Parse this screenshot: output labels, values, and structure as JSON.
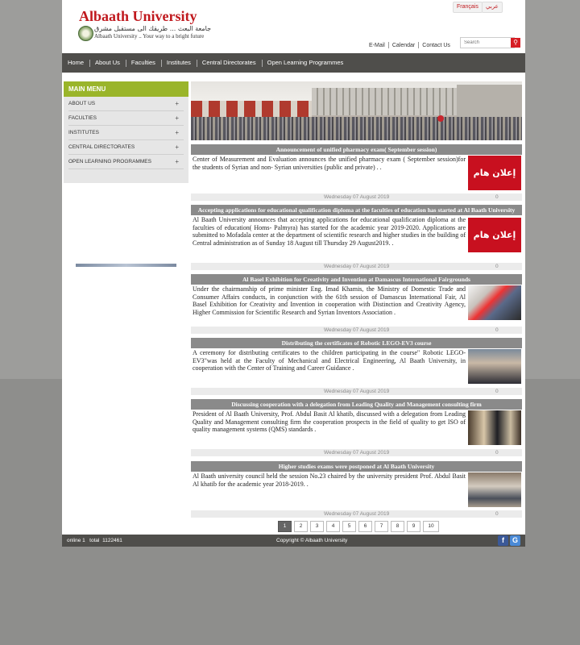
{
  "header": {
    "university_name": "Albaath University",
    "arabic_tagline": "جامعة البعث ... طريقك الى مستقبل مشرق",
    "slogan": "Albaath University .. Your way to a bright future",
    "languages": [
      "Français",
      "عربي"
    ],
    "top_links": [
      "E-Mail",
      "Calendar",
      "Contact Us"
    ],
    "search_placeholder": "Search"
  },
  "nav": [
    "Home",
    "About Us",
    "Faculties",
    "Institutes",
    "Central Directorates",
    "Open Learning Programmes"
  ],
  "sidebar": {
    "title": "MAIN MENU",
    "items": [
      "ABOUT US",
      "FACULTIES",
      "INSTITUTES",
      "CENTRAL DIRECTORATES",
      "OPEN LEARNING PROGRAMMES"
    ],
    "expand_symbol": "+"
  },
  "news": [
    {
      "title": "Announcement of unified pharmacy exam( September session)",
      "body": "Center of Measurement and Evaluation announces the unified pharmacy exam ( September session)for the students of Syrian and non- Syrian universities (public and private) . .",
      "image_text": "إعلان هام",
      "date": "Wednesday 07 August 2019",
      "count": "0"
    },
    {
      "title": "Accepting applications for educational qualification diploma at the faculties of education has started at Al Baath University",
      "body": "Al Baath University announces that accepting applications for educational qualification diploma at the faculties of education( Homs- Palmyra) has started for the academic year 2019-2020. Applications are submitted to Mofadala center at the department of scientific research and higher studies in the building of Central administration as of Sunday 18 August till Thursday 29 August2019. .",
      "image_text": "إعلان هام",
      "date": "Wednesday 07 August 2019",
      "count": "0"
    },
    {
      "title": "Al Basel Exhibition for Creativity and Invention at Damascus International Fairgrounds",
      "body": "Under the chairmanship of prime minister Eng. Imad Khamis, the Ministry of Domestic Trade and Consumer Affairs conducts, in conjunction with the 61th session of Damascus International Fair, Al Basel Exhibition for Creativity and Invention in cooperation with Distinction and Creativity Agency, Higher Commission for Scientific Research and Syrian Inventors Association .",
      "date": "Wednesday 07 August 2019",
      "count": "0"
    },
    {
      "title": "Distributing the certificates of Robotic LEGO-EV3 course",
      "body": "A ceremony for distributing certificates to the children participating in the course\" Robotic LEGO-EV3\"was held at the Faculty of Mechanical and Electrical Engineering, Al Baath University, in cooperation with the Center of Training and Career Guidance .",
      "date": "Wednesday 07 August 2019",
      "count": "0"
    },
    {
      "title": "Discussing cooperation with a delegation from Leading Quality and Management consulting firm",
      "body": "President of Al Baath University, Prof. Abdul Basit Al khatib, discussed with a delegation from Leading Quality and Management consulting firm the cooperation prospects in the field of quality to get ISO of quality management systems (QMS) standards .",
      "date": "Wednesday 07 August 2019",
      "count": "0"
    },
    {
      "title": "Higher studies exams were postponed at Al Baath University",
      "body": "Al Baath university council held the session No.23 chaired by the university president Prof. Abdul Basit Al khatib for the academic year 2018-2019. .",
      "date": "Wednesday 07 August 2019",
      "count": "0"
    }
  ],
  "pagination": [
    "1",
    "2",
    "3",
    "4",
    "5",
    "6",
    "7",
    "8",
    "9",
    "10"
  ],
  "pagination_active": "1",
  "footer": {
    "online": "online 1   total  1122461",
    "copyright": "Copyright © Albaath University",
    "social": [
      "f",
      "G"
    ]
  },
  "colors": {
    "brand_red": "#c0181d",
    "nav_dark": "#4f4e4b",
    "menu_green": "#9ab52a",
    "news_header_gray": "#8a8a8a"
  }
}
